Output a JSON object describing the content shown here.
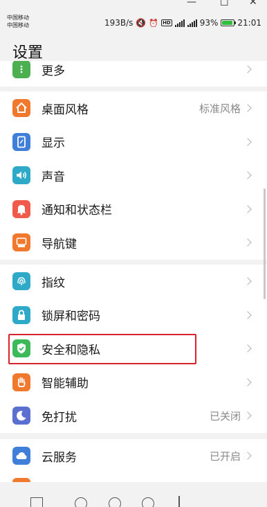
{
  "status_bar": {
    "carrier_1": "中国移动",
    "carrier_2": "中国移动",
    "net_speed": "193B/s",
    "hd_badge": "HD",
    "battery_percent": "93%",
    "time": "21:01"
  },
  "header": {
    "title": "设置"
  },
  "sections": [
    {
      "items": [
        {
          "icon": "more-icon",
          "color": "#4caf50",
          "label": "更多",
          "value": ""
        }
      ]
    },
    {
      "items": [
        {
          "icon": "home-theme-icon",
          "color": "#f0792e",
          "label": "桌面风格",
          "value": "标准风格"
        },
        {
          "icon": "display-icon",
          "color": "#3f7fd9",
          "label": "显示",
          "value": ""
        },
        {
          "icon": "sound-icon",
          "color": "#2fa9c8",
          "label": "声音",
          "value": ""
        },
        {
          "icon": "notification-bell-icon",
          "color": "#ef5a4a",
          "label": "通知和状态栏",
          "value": ""
        },
        {
          "icon": "navigation-key-icon",
          "color": "#f0792e",
          "label": "导航键",
          "value": ""
        }
      ]
    },
    {
      "items": [
        {
          "icon": "fingerprint-icon",
          "color": "#2fa9c8",
          "label": "指纹",
          "value": ""
        },
        {
          "icon": "lock-icon",
          "color": "#2fa9c8",
          "label": "锁屏和密码",
          "value": ""
        },
        {
          "icon": "shield-icon",
          "color": "#3cba5a",
          "label": "安全和隐私",
          "value": ""
        },
        {
          "icon": "hand-icon",
          "color": "#f0792e",
          "label": "智能辅助",
          "value": ""
        },
        {
          "icon": "moon-icon",
          "color": "#5a6fd0",
          "label": "免打扰",
          "value": "已关闭"
        }
      ]
    },
    {
      "items": [
        {
          "icon": "cloud-icon",
          "color": "#3f7fd9",
          "label": "云服务",
          "value": "已开启"
        }
      ]
    }
  ]
}
